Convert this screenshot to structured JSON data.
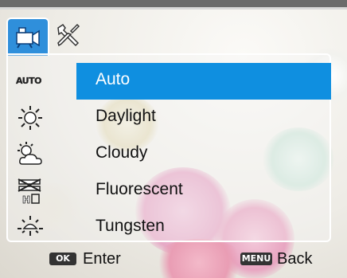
{
  "tabs": [
    {
      "name": "camera-tab",
      "icon": "camera-icon",
      "selected": true
    },
    {
      "name": "settings-tab",
      "icon": "wrench-settings-icon",
      "selected": false
    }
  ],
  "menu": {
    "items": [
      {
        "label": "Auto",
        "icon": "awb-auto-icon",
        "icon_text": "AUTO",
        "selected": true
      },
      {
        "label": "Daylight",
        "icon": "sun-daylight-icon",
        "selected": false
      },
      {
        "label": "Cloudy",
        "icon": "cloudy-icon",
        "selected": false
      },
      {
        "label": "Fluorescent",
        "icon": "fluorescent-icon",
        "selected": false
      },
      {
        "label": "Tungsten",
        "icon": "tungsten-bulb-icon",
        "selected": false
      }
    ]
  },
  "footer": {
    "ok_key": "OK",
    "ok_label": "Enter",
    "menu_key": "MENU",
    "menu_label": "Back"
  },
  "colors": {
    "selection": "#0f8fe0",
    "tab_active": "#2f8fdb"
  }
}
